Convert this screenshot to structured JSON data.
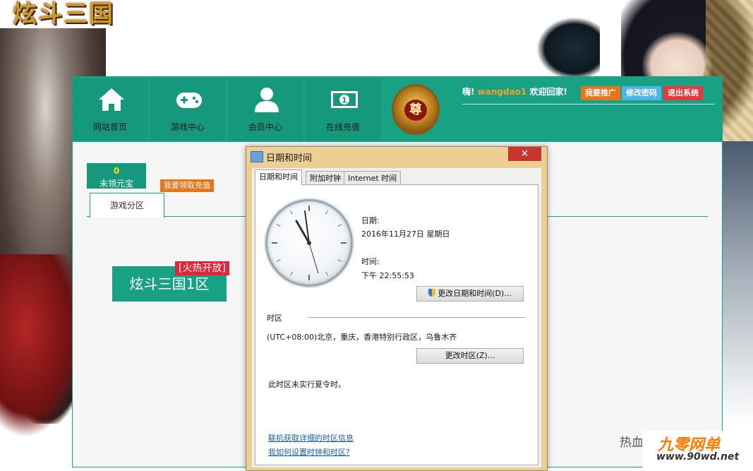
{
  "game_logo_text": "炫斗三国",
  "nav": [
    {
      "label": "网站首页",
      "icon": "home-icon"
    },
    {
      "label": "游戏中心",
      "icon": "gamepad-icon"
    },
    {
      "label": "会员中心",
      "icon": "user-icon"
    },
    {
      "label": "在线充值",
      "icon": "money-icon"
    }
  ],
  "crest_char": "尊",
  "header": {
    "greeting": "嗨!",
    "username": "wangdao1",
    "welcome": "欢迎回家!",
    "buttons": [
      {
        "label": "我要推广",
        "color": "#e8751a"
      },
      {
        "label": "修改密码",
        "color": "#4fb5e6"
      },
      {
        "label": "退出系统",
        "color": "#e2383e"
      }
    ]
  },
  "account": {
    "gold_amount": "0",
    "gold_label": "未领元宝",
    "claim_button": "我要领取充值"
  },
  "tabs": {
    "zone_tab": "游戏分区"
  },
  "server": {
    "name": "炫斗三国1区",
    "badge": "[火热开放]"
  },
  "partial_text": "热血",
  "watermark": {
    "line1": "九零网单",
    "line2": "www.90wd.net"
  },
  "dialog": {
    "title": "日期和时间",
    "close_symbol": "✕",
    "tabs": [
      "日期和时间",
      "附加时钟",
      "Internet 时间"
    ],
    "date_label": "日期:",
    "date_value": "2016年11月27日 星期日",
    "time_label": "时间:",
    "time_value": "下午 22:55:53",
    "change_datetime_button": "更改日期和时间(D)...",
    "timezone_heading": "时区",
    "timezone_value": "(UTC+08:00)北京，重庆，香港特别行政区，乌鲁木齐",
    "change_timezone_button": "更改时区(Z)...",
    "dst_note": "此时区未实行夏令时。",
    "link_online": "联机获取详细的时区信息",
    "link_help": "我如何设置时钟和时区?"
  },
  "colors": {
    "site_green": "#19a184",
    "dialog_frame": "#ebcf95",
    "close_red": "#c7352c"
  }
}
